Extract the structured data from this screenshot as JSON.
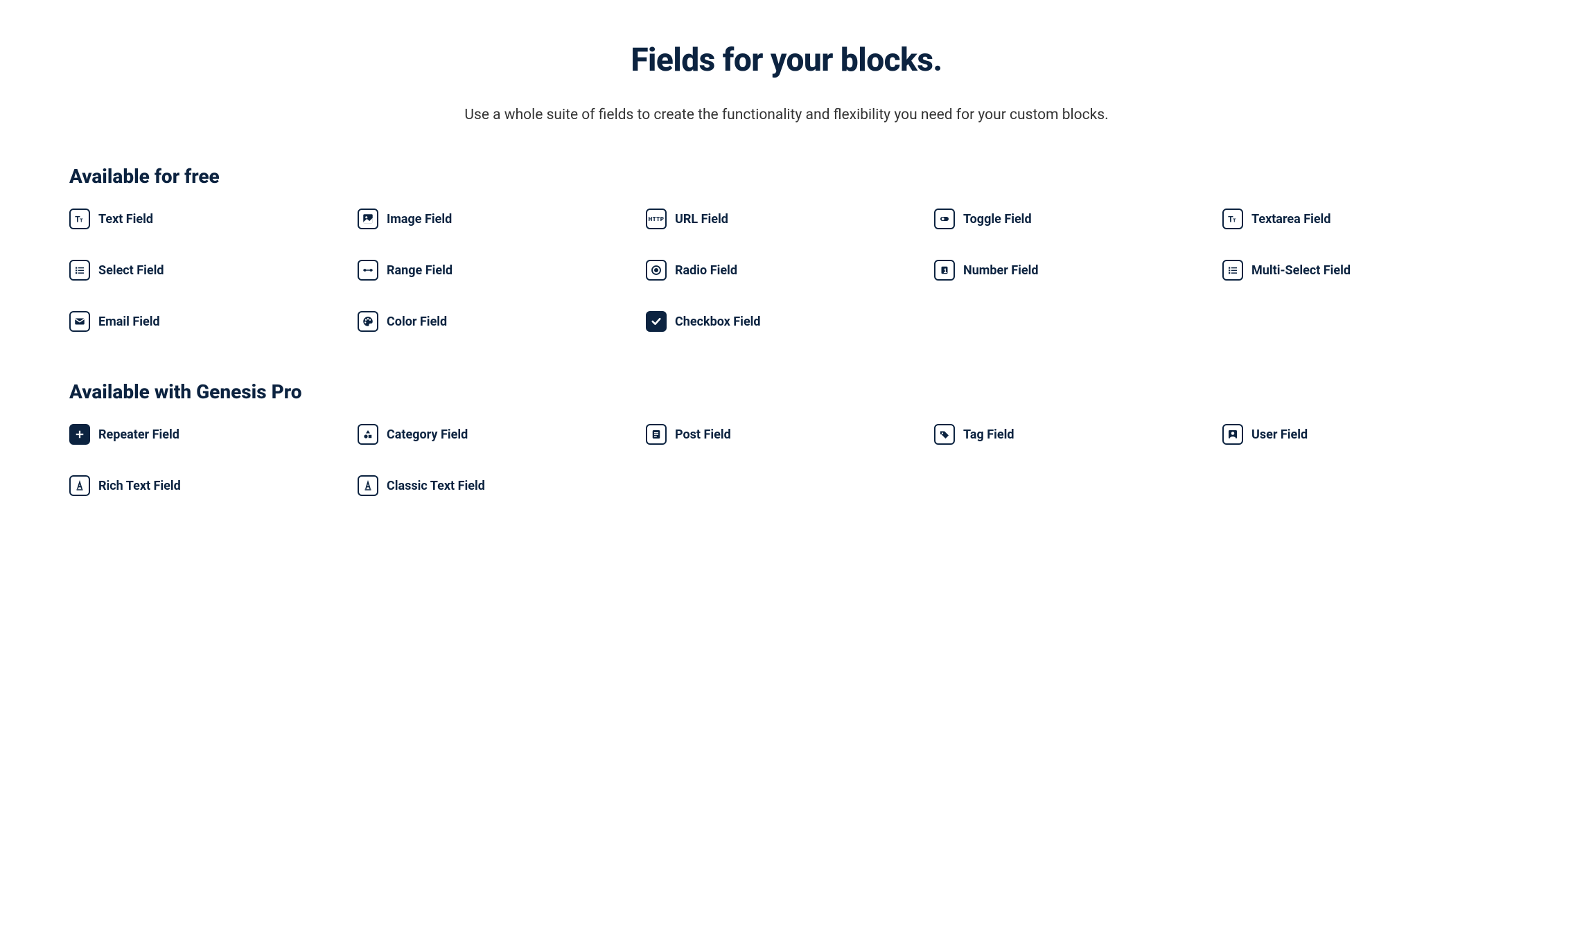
{
  "title": "Fields for your blocks.",
  "subtitle": "Use a whole suite of fields to create the functionality and flexibility you need for your custom blocks.",
  "sections": [
    {
      "heading": "Available for free",
      "fields": [
        {
          "icon": "text-icon",
          "label": "Text Field"
        },
        {
          "icon": "image-icon",
          "label": "Image Field"
        },
        {
          "icon": "url-icon",
          "label": "URL Field"
        },
        {
          "icon": "toggle-icon",
          "label": "Toggle Field"
        },
        {
          "icon": "textarea-icon",
          "label": "Textarea Field"
        },
        {
          "icon": "select-icon",
          "label": "Select Field"
        },
        {
          "icon": "range-icon",
          "label": "Range Field"
        },
        {
          "icon": "radio-icon",
          "label": "Radio Field"
        },
        {
          "icon": "number-icon",
          "label": "Number Field"
        },
        {
          "icon": "multiselect-icon",
          "label": "Multi-Select Field"
        },
        {
          "icon": "email-icon",
          "label": "Email Field"
        },
        {
          "icon": "color-icon",
          "label": "Color Field"
        },
        {
          "icon": "checkbox-icon",
          "label": "Checkbox Field"
        }
      ]
    },
    {
      "heading": "Available with Genesis Pro",
      "fields": [
        {
          "icon": "repeater-icon",
          "label": "Repeater Field"
        },
        {
          "icon": "category-icon",
          "label": "Category Field"
        },
        {
          "icon": "post-icon",
          "label": "Post Field"
        },
        {
          "icon": "tag-icon",
          "label": "Tag Field"
        },
        {
          "icon": "user-icon",
          "label": "User Field"
        },
        {
          "icon": "richtext-icon",
          "label": "Rich Text Field"
        },
        {
          "icon": "classictext-icon",
          "label": "Classic Text Field"
        }
      ]
    }
  ]
}
